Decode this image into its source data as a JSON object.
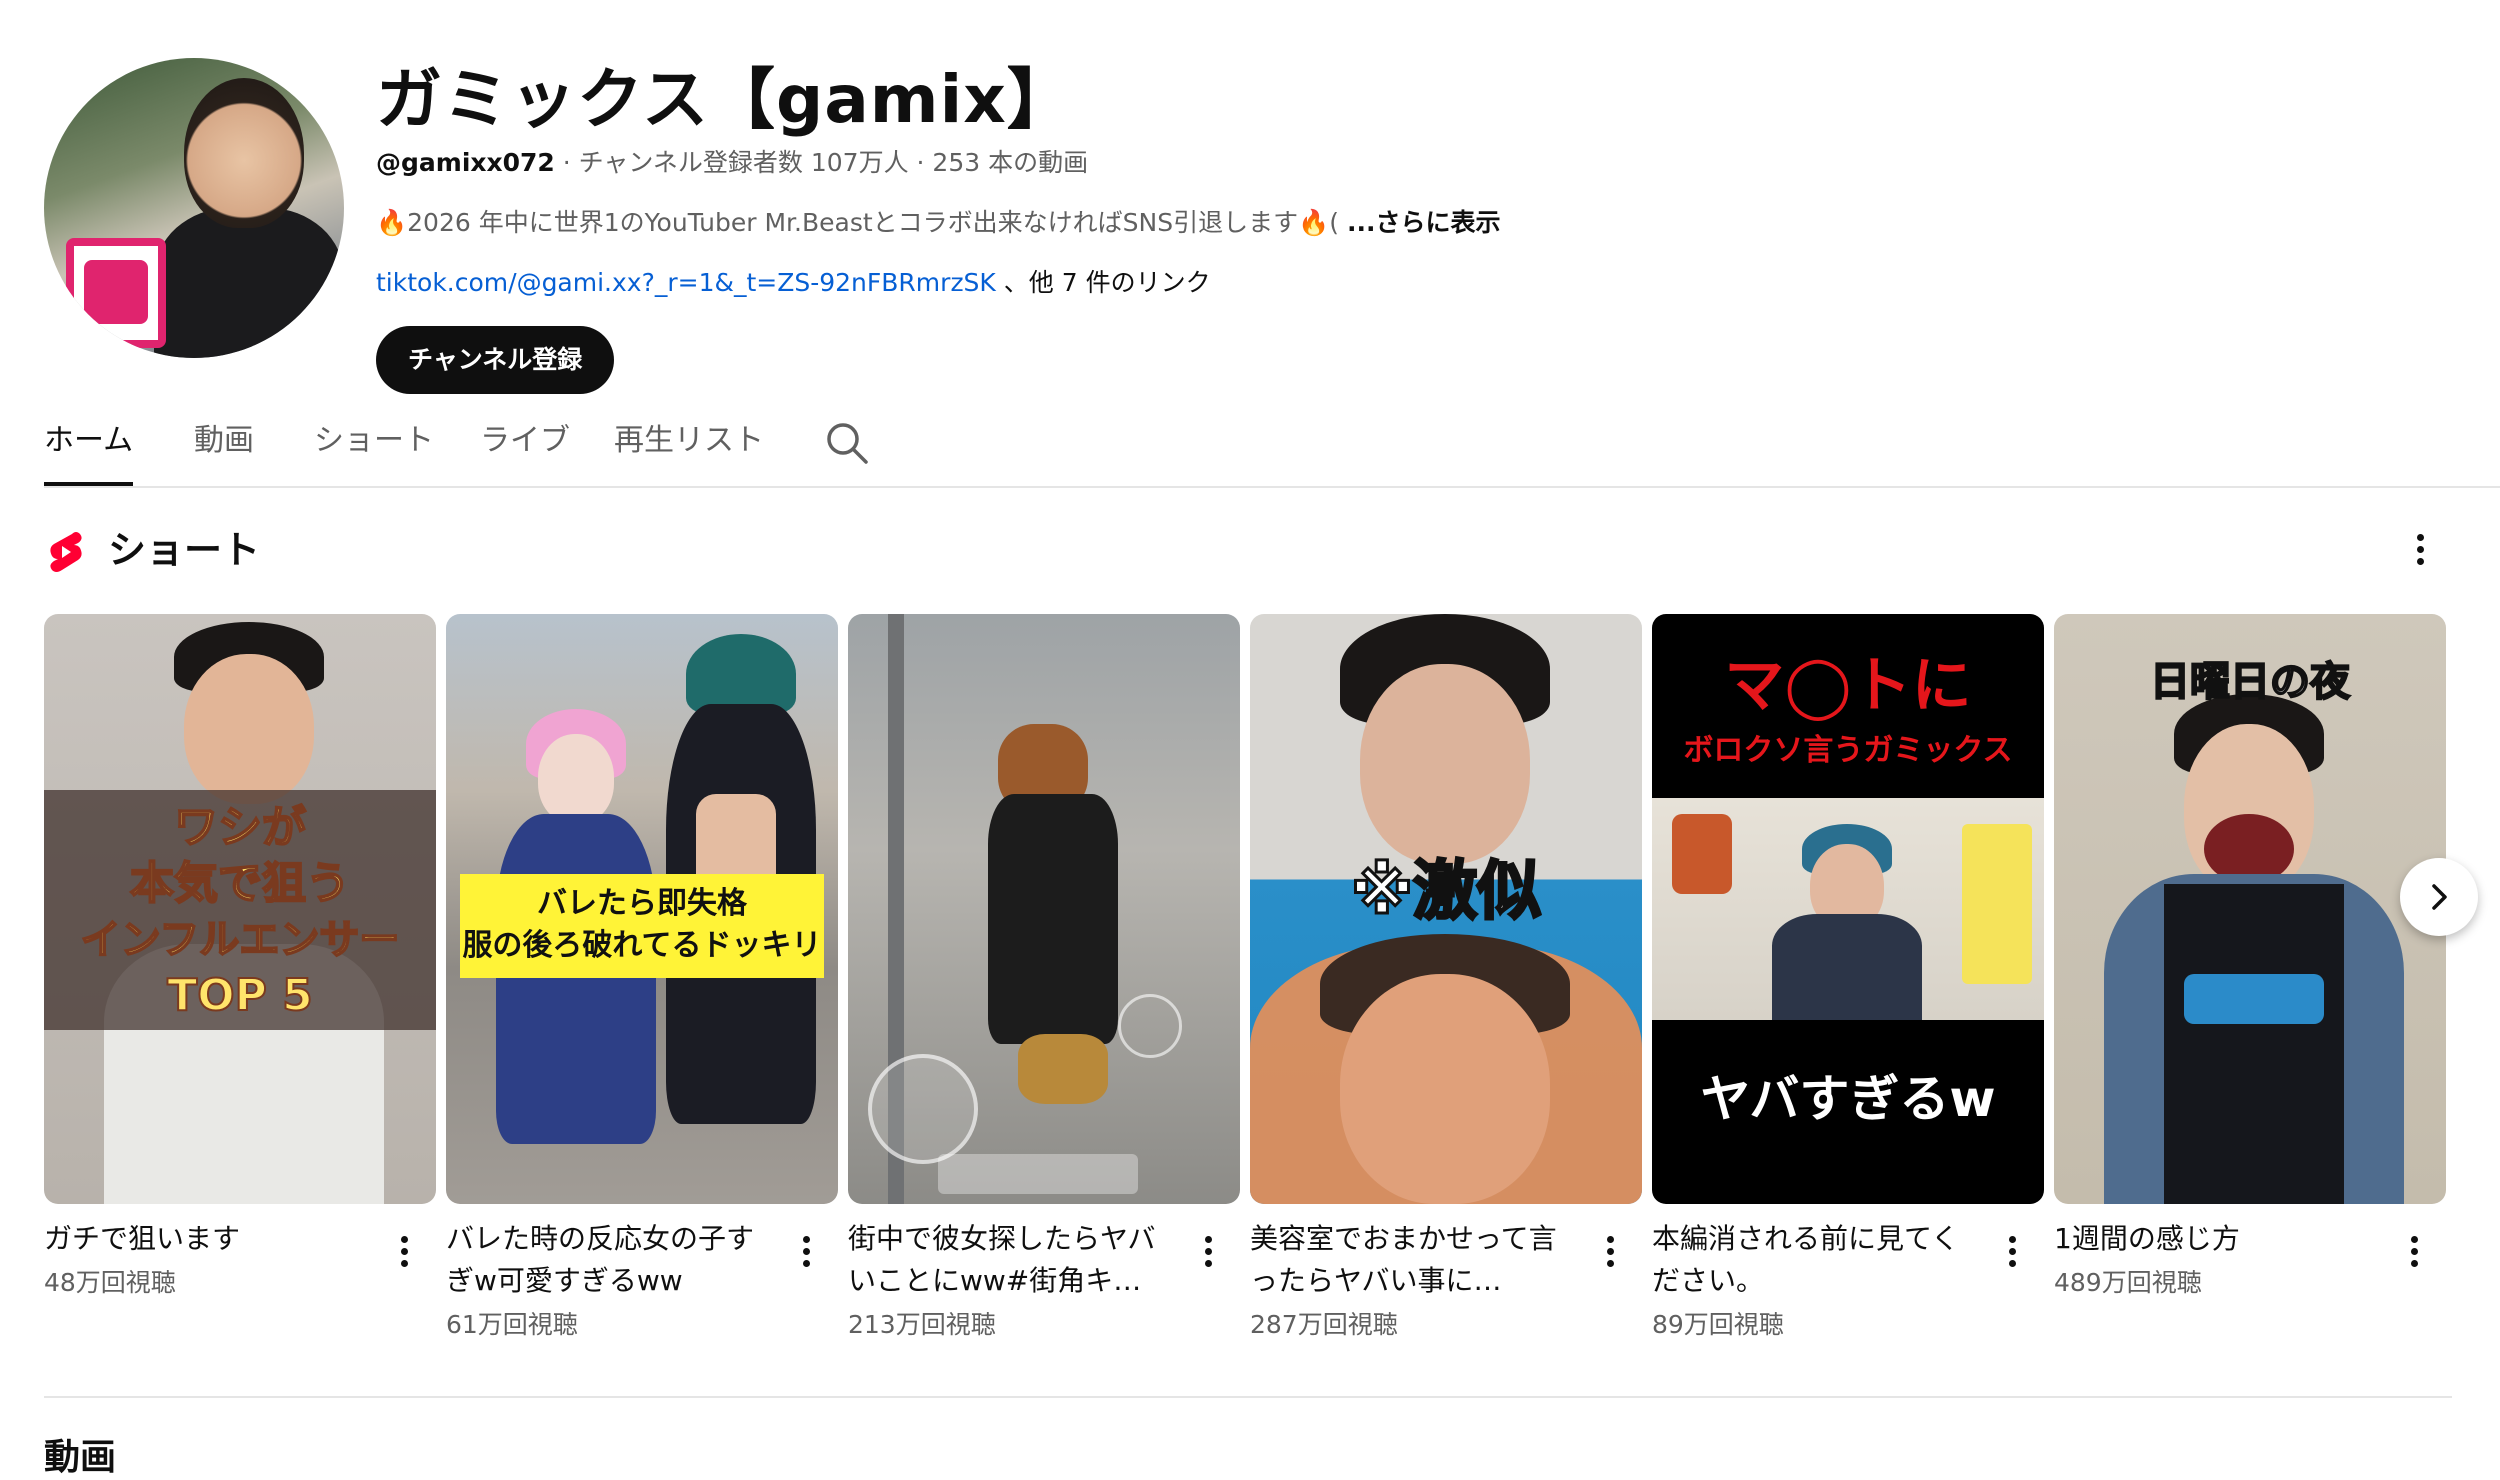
{
  "channel": {
    "name": "ガミックス【gamix】",
    "handle": "@gamixx072",
    "meta_rest": " · チャンネル登録者数 107万人 · 253 本の動画",
    "description": "🔥2026 年中に世界1のYouTuber Mr.Beastとコラボ出来なければSNS引退します🔥(",
    "description_more": "...さらに表示",
    "link_url": "tiktok.com/@gami.xx?_r=1&_t=ZS-92nFBRmrzSK",
    "link_more": " 、他 7 件のリンク",
    "subscribe_label": "チャンネル登録"
  },
  "tabs": [
    {
      "label": "ホーム",
      "active": true
    },
    {
      "label": "動画",
      "active": false
    },
    {
      "label": "ショート",
      "active": false
    },
    {
      "label": "ライブ",
      "active": false
    },
    {
      "label": "再生リスト",
      "active": false
    }
  ],
  "shorts_shelf": {
    "title": "ショート",
    "items": [
      {
        "title": "ガチで狙います",
        "views": "48万回視聴",
        "overlay": [
          "ワシが",
          "本気で狙う",
          "インフルエンサー",
          "TOP 5"
        ]
      },
      {
        "title": "バレた時の反応女の子すぎw可愛すぎるww",
        "views": "61万回視聴",
        "overlay": [
          "バレたら即失格",
          "服の後ろ破れてるドッキリ"
        ]
      },
      {
        "title": "街中で彼女探したらヤバいことにww#街角キ…",
        "views": "213万回視聴",
        "overlay": []
      },
      {
        "title": "美容室でおまかせって言ったらヤバい事に…",
        "views": "287万回視聴",
        "overlay": [
          "※激似"
        ]
      },
      {
        "title": "本編消される前に見てください。",
        "views": "89万回視聴",
        "overlay": [
          "マ◯トに",
          "ボロクソ言うガミックス",
          "ヤバすぎるw"
        ]
      },
      {
        "title": "1週間の感じ方",
        "views": "489万回視聴",
        "overlay": [
          "日曜日の夜"
        ]
      }
    ]
  },
  "videos_heading": "動画",
  "colors": {
    "accent_red": "#ff0033",
    "link_blue": "#065fd4",
    "text_primary": "#0f0f0f",
    "text_secondary": "#606060"
  }
}
